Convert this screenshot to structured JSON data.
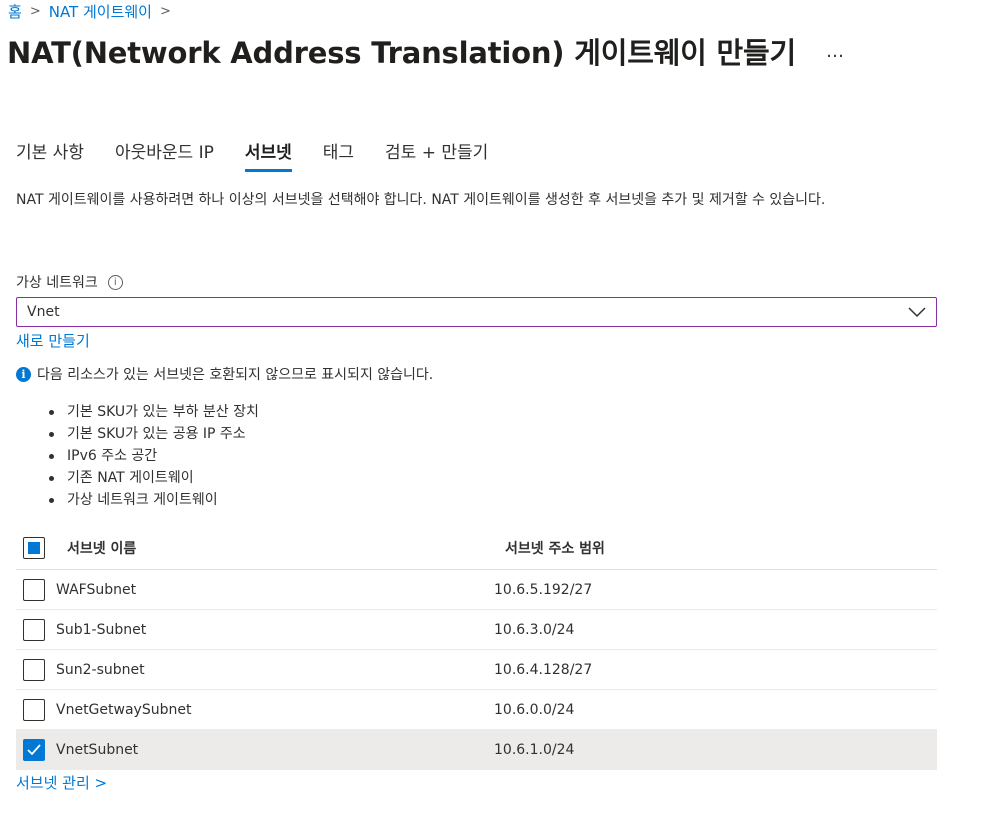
{
  "breadcrumb": {
    "home": "홈",
    "nat": "NAT 게이트웨이"
  },
  "title": "NAT(Network Address Translation) 게이트웨이 만들기",
  "more": "…",
  "tabs": [
    {
      "label": "기본 사항"
    },
    {
      "label": "아웃바운드 IP"
    },
    {
      "label": "서브넷"
    },
    {
      "label": "태그"
    },
    {
      "label": "검토 + 만들기"
    }
  ],
  "active_tab": "서브넷",
  "description": "NAT 게이트웨이를 사용하려면 하나 이상의 서브넷을 선택해야 합니다. NAT 게이트웨이를 생성한 후 서브넷을 추가 및 제거할 수 있습니다.",
  "vnet": {
    "label": "가상 네트워크",
    "info": "i",
    "value": "Vnet",
    "create_link": "새로 만들기"
  },
  "note": {
    "text": "다음 리소스가 있는 서브넷은 호환되지 않으므로 표시되지 않습니다.",
    "items": [
      "기본 SKU가 있는 부하 분산 장치",
      "기본 SKU가 있는 공용 IP 주소",
      "IPv6 주소 공간",
      "기존 NAT 게이트웨이",
      "가상 네트워크 게이트웨이"
    ]
  },
  "table": {
    "headers": {
      "name": "서브넷 이름",
      "range": "서브넷 주소 범위"
    },
    "rows": [
      {
        "name": "WAFSubnet",
        "range": "10.6.5.192/27",
        "checked": false
      },
      {
        "name": "Sub1-Subnet",
        "range": "10.6.3.0/24",
        "checked": false
      },
      {
        "name": "Sun2-subnet",
        "range": "10.6.4.128/27",
        "checked": false
      },
      {
        "name": "VnetGetwaySubnet",
        "range": "10.6.0.0/24",
        "checked": false
      },
      {
        "name": "VnetSubnet",
        "range": "10.6.1.0/24",
        "checked": true
      }
    ]
  },
  "manage_link": "서브넷 관리 >",
  "colors": {
    "accent": "#0078d4",
    "focus_border": "#8a2da5",
    "selected_row": "#edebe9"
  }
}
